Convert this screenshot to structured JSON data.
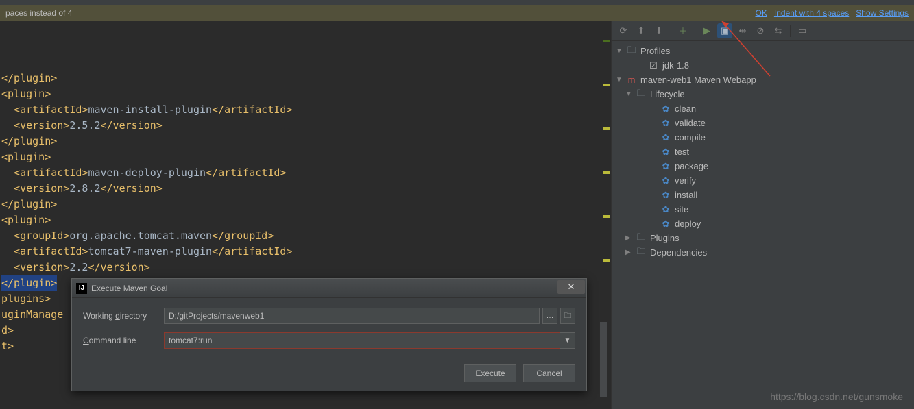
{
  "topbar": {
    "hint_left": "paces instead of 4",
    "link_ok": "OK",
    "link_indent": "Indent with 4 spaces",
    "link_settings": "Show Settings"
  },
  "editor": {
    "lines": [
      {
        "frag": [
          {
            "c": "t-tag",
            "t": "</plugin>"
          }
        ]
      },
      {
        "frag": [
          {
            "c": "t-tag",
            "t": "<plugin>"
          }
        ]
      },
      {
        "frag": [
          {
            "c": "t-text",
            "t": "  "
          },
          {
            "c": "t-tag",
            "t": "<artifactId>"
          },
          {
            "c": "t-text",
            "t": "maven-install-plugin"
          },
          {
            "c": "t-tag",
            "t": "</artifactId>"
          }
        ]
      },
      {
        "frag": [
          {
            "c": "t-text",
            "t": "  "
          },
          {
            "c": "t-tag",
            "t": "<version>"
          },
          {
            "c": "t-text",
            "t": "2.5.2"
          },
          {
            "c": "t-tag",
            "t": "</version>"
          }
        ]
      },
      {
        "frag": [
          {
            "c": "t-tag",
            "t": "</plugin>"
          }
        ]
      },
      {
        "frag": [
          {
            "c": "t-tag",
            "t": "<plugin>"
          }
        ]
      },
      {
        "frag": [
          {
            "c": "t-text",
            "t": "  "
          },
          {
            "c": "t-tag",
            "t": "<artifactId>"
          },
          {
            "c": "t-text",
            "t": "maven-deploy-plugin"
          },
          {
            "c": "t-tag",
            "t": "</artifactId>"
          }
        ]
      },
      {
        "frag": [
          {
            "c": "t-text",
            "t": "  "
          },
          {
            "c": "t-tag",
            "t": "<version>"
          },
          {
            "c": "t-text",
            "t": "2.8.2"
          },
          {
            "c": "t-tag",
            "t": "</version>"
          }
        ]
      },
      {
        "frag": [
          {
            "c": "t-tag",
            "t": "</plugin>"
          }
        ]
      },
      {
        "frag": [
          {
            "c": "t-text",
            "t": ""
          }
        ]
      },
      {
        "frag": [
          {
            "c": "t-tag",
            "t": "<plugin>"
          }
        ]
      },
      {
        "frag": [
          {
            "c": "t-text",
            "t": "  "
          },
          {
            "c": "t-tag",
            "t": "<groupId>"
          },
          {
            "c": "t-text",
            "t": "org.apache.tomcat.maven"
          },
          {
            "c": "t-tag",
            "t": "</groupId>"
          }
        ]
      },
      {
        "frag": [
          {
            "c": "t-text",
            "t": "  "
          },
          {
            "c": "t-tag",
            "t": "<artifactId>"
          },
          {
            "c": "t-text",
            "t": "tomcat7-maven-plugin"
          },
          {
            "c": "t-tag",
            "t": "</artifactId>"
          }
        ]
      },
      {
        "frag": [
          {
            "c": "t-text",
            "t": "  "
          },
          {
            "c": "t-tag",
            "t": "<version>"
          },
          {
            "c": "t-text",
            "t": "2.2"
          },
          {
            "c": "t-tag",
            "t": "</version>"
          }
        ]
      },
      {
        "frag": [
          {
            "c": "t-tag",
            "t": "</plugin>"
          }
        ],
        "selected": true
      },
      {
        "frag": [
          {
            "c": "t-text",
            "t": ""
          }
        ]
      },
      {
        "frag": [
          {
            "c": "t-tag",
            "t": "plugins>"
          }
        ]
      },
      {
        "frag": [
          {
            "c": "t-tag",
            "t": "uginManage"
          }
        ]
      },
      {
        "frag": [
          {
            "c": "t-tag",
            "t": "d>"
          }
        ]
      },
      {
        "frag": [
          {
            "c": "t-tag",
            "t": "t>"
          }
        ]
      }
    ]
  },
  "maven_panel": {
    "profiles_label": "Profiles",
    "profile_jdk": "jdk-1.8",
    "project_name": "maven-web1 Maven Webapp",
    "lifecycle_label": "Lifecycle",
    "lifecycle": [
      "clean",
      "validate",
      "compile",
      "test",
      "package",
      "verify",
      "install",
      "site",
      "deploy"
    ],
    "plugins_label": "Plugins",
    "deps_label": "Dependencies"
  },
  "dialog": {
    "title": "Execute Maven Goal",
    "wd_label_pre": "Working ",
    "wd_label_ul": "d",
    "wd_label_post": "irectory",
    "wd_value": "D:/gitProjects/mavenweb1",
    "cl_label_ul": "C",
    "cl_label_post": "ommand line",
    "cl_value": "tomcat7:run",
    "execute_ul": "E",
    "execute_post": "xecute",
    "cancel": "Cancel"
  },
  "watermark": "https://blog.csdn.net/gunsmoke"
}
